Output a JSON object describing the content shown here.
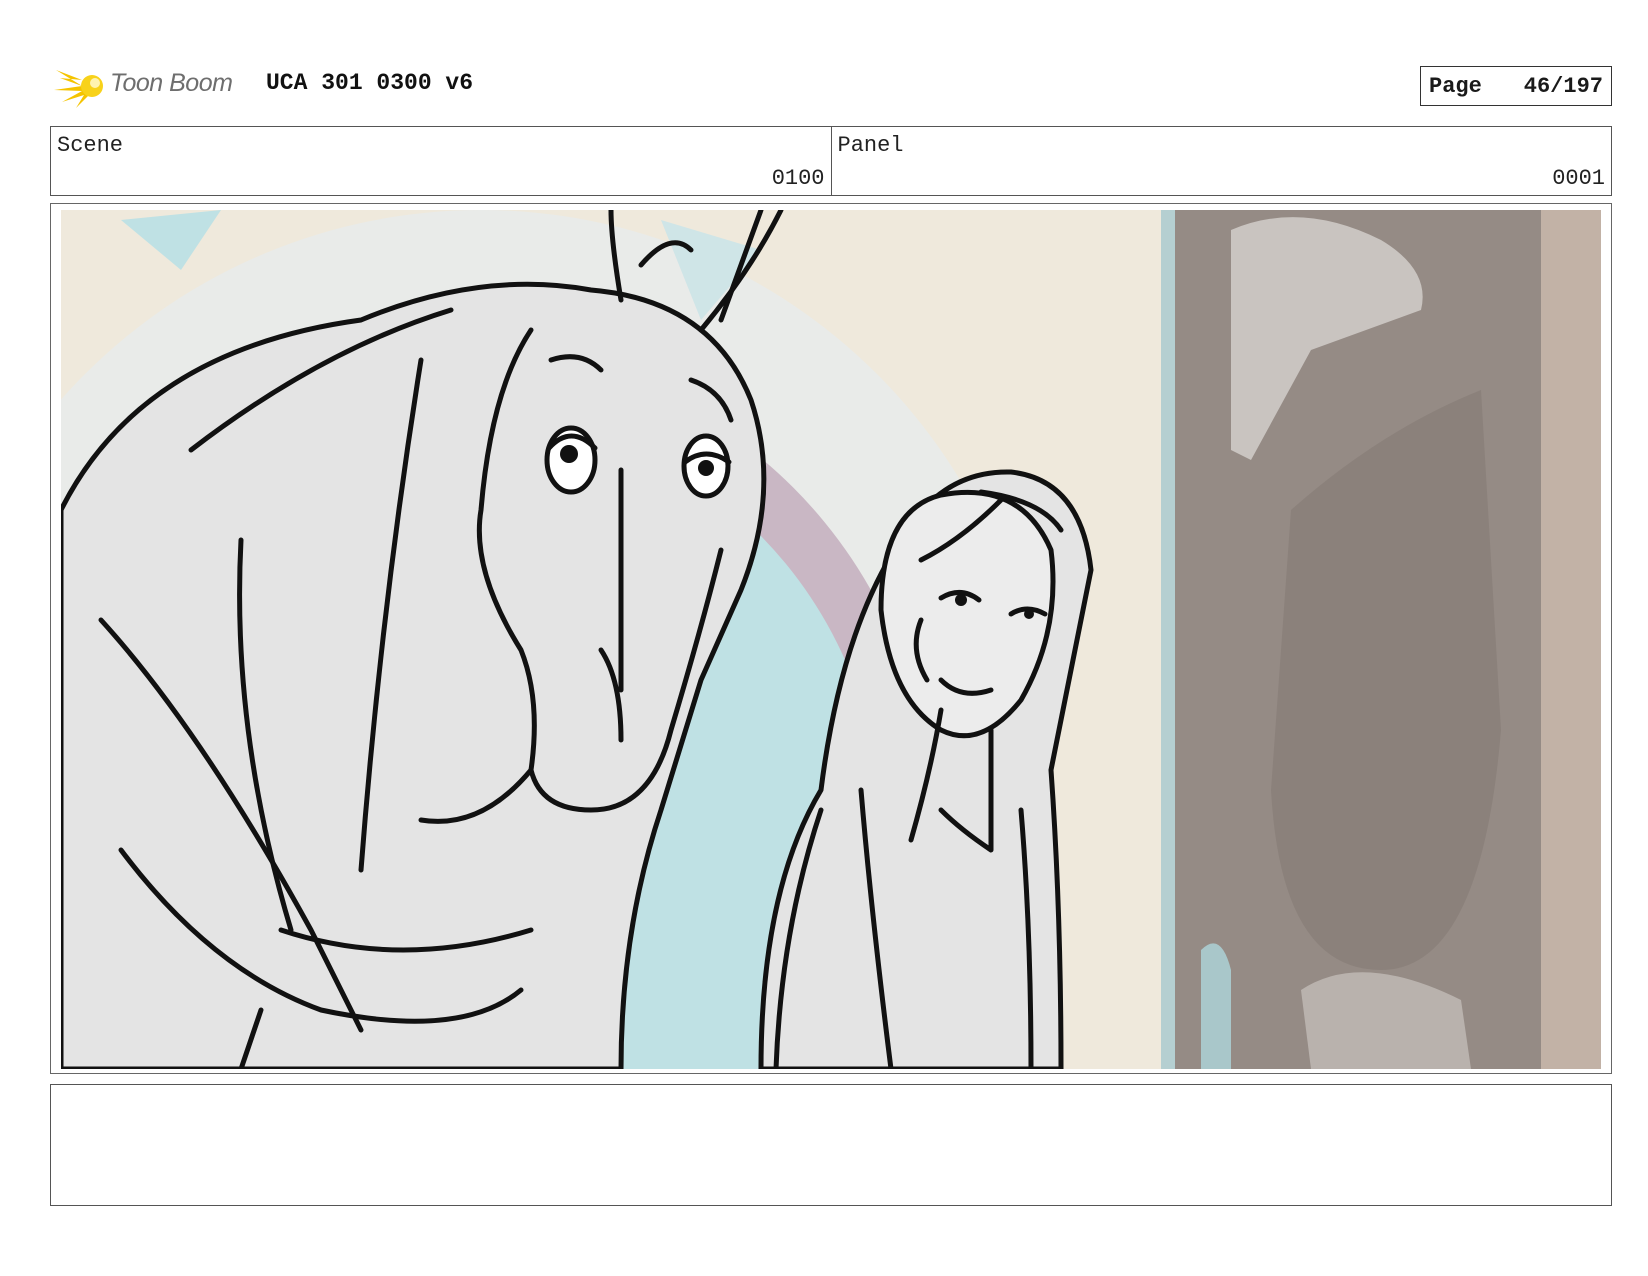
{
  "header": {
    "logo_text": "Toon Boom",
    "doc_title": "UCA 301 0300 v6",
    "page_label": "Page",
    "page_number": "46/197"
  },
  "info": {
    "scene_label": "Scene",
    "scene_value": "0100",
    "panel_label": "Panel",
    "panel_value": "0001"
  },
  "notes": {
    "text": ""
  },
  "colors": {
    "logo_yellow": "#f5c400",
    "wall_cream": "#efe9dc",
    "window_teal": "#bfe1e4",
    "window_mauve": "#c9b7c4",
    "door_taupe": "#958b85",
    "character_fill": "#e4e4e4"
  },
  "icons": [
    "toon-boom-logo-icon"
  ]
}
